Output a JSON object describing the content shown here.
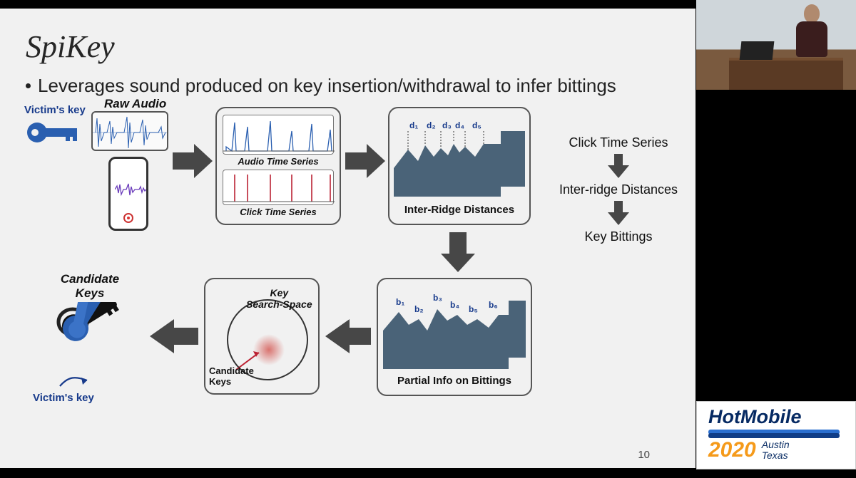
{
  "slide": {
    "title": "SpiKey",
    "bullet": "Leverages sound produced on key insertion/withdrawal to infer bittings",
    "page": "10",
    "labels": {
      "victims_key_top": "Victim's key",
      "raw_audio": "Raw Audio",
      "audio_ts": "Audio Time Series",
      "click_ts": "Click Time Series",
      "inter_ridge": "Inter-Ridge Distances",
      "d": [
        "d₁",
        "d₂",
        "d₃",
        "d₄",
        "d₅"
      ],
      "partial_info": "Partial Info on Bittings",
      "b": [
        "b₁",
        "b₂",
        "b₃",
        "b₄",
        "b₅",
        "b₆"
      ],
      "key_search_space": "Key\nSearch-Space",
      "candidate_keys_box": "Candidate\nKeys",
      "candidate_keys_out": "Candidate\nKeys",
      "victims_key_bottom": "Victim's key"
    },
    "side_flow": {
      "a": "Click Time Series",
      "b": "Inter-ridge Distances",
      "c": "Key Bittings"
    }
  },
  "logo": {
    "name_prefix": "Hot",
    "name_suffix": "Mobile",
    "year": "2020",
    "city": "Austin",
    "state": "Texas"
  }
}
